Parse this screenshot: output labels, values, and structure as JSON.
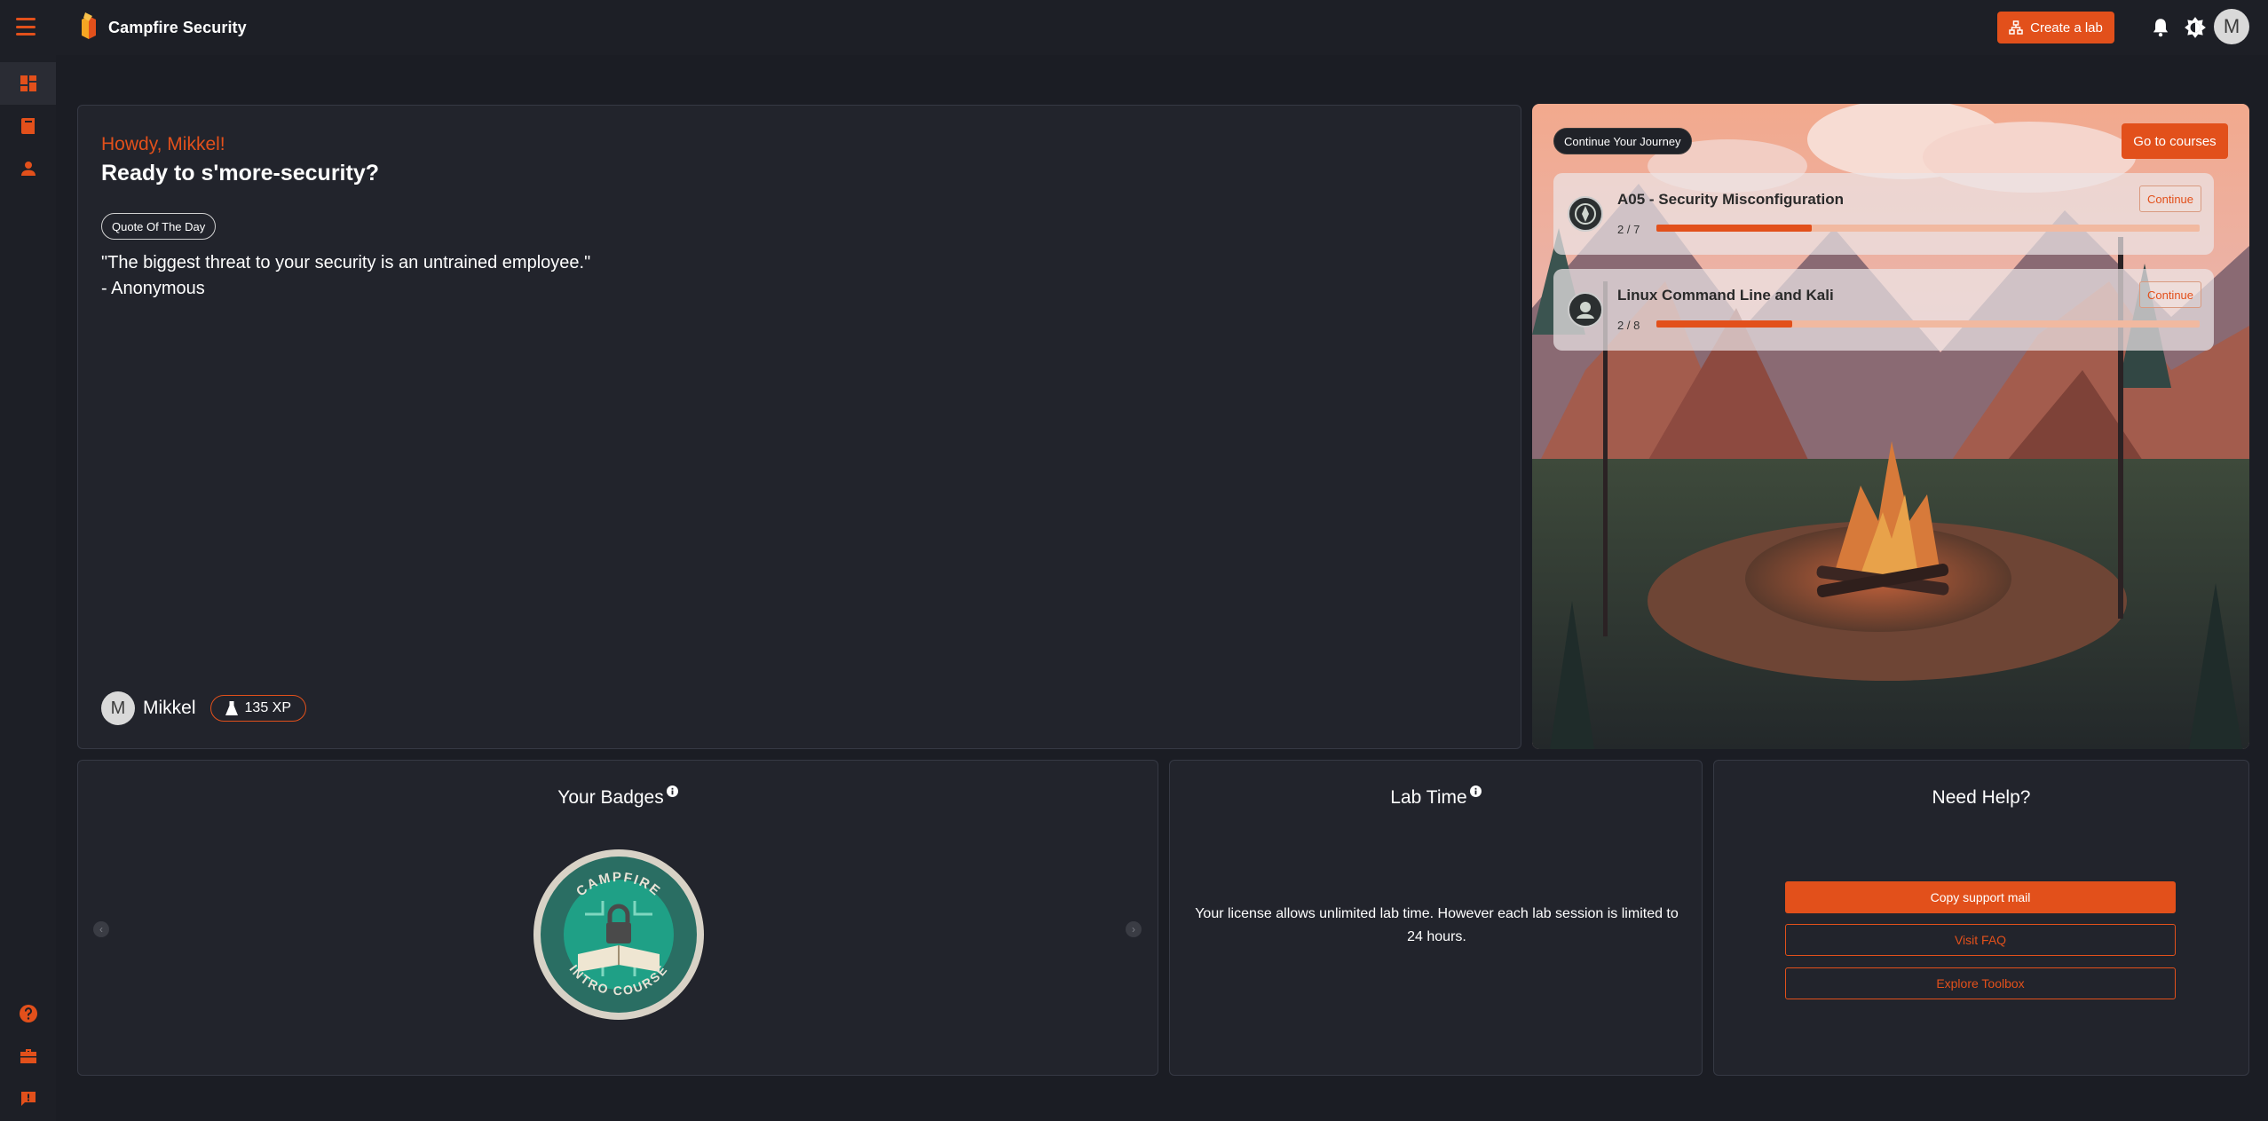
{
  "app": {
    "name": "Campfire Security"
  },
  "topbar": {
    "create_lab_label": "Create a lab",
    "avatar_initial": "M"
  },
  "hero": {
    "greeting": "Howdy, Mikkel!",
    "headline": "Ready to s'more-security?",
    "quote_chip": "Quote Of The Day",
    "quote": "\"The biggest threat to your security is an untrained employee.\"",
    "quote_author": "- Anonymous",
    "user_initial": "M",
    "user_name": "Mikkel",
    "xp": "135 XP"
  },
  "journey": {
    "chip": "Continue Your Journey",
    "go_courses_label": "Go to courses",
    "courses": [
      {
        "title": "A05 - Security Misconfiguration",
        "progress_text": "2 / 7",
        "progress": 0.2857,
        "continue_label": "Continue"
      },
      {
        "title": "Linux Command Line and Kali",
        "progress_text": "2 / 8",
        "progress": 0.25,
        "continue_label": "Continue"
      }
    ]
  },
  "badges": {
    "title": "Your Badges",
    "badge_top_text": "CAMPFIRE",
    "badge_bottom_text": "INTRO COURSE"
  },
  "labtime": {
    "title": "Lab Time",
    "text": "Your license allows unlimited lab time. However each lab session is limited to 24 hours."
  },
  "help": {
    "title": "Need Help?",
    "copy_mail_label": "Copy support mail",
    "faq_label": "Visit FAQ",
    "toolbox_label": "Explore Toolbox"
  },
  "colors": {
    "accent": "#e2501b",
    "background": "#1b1d24",
    "card": "#22242c"
  }
}
